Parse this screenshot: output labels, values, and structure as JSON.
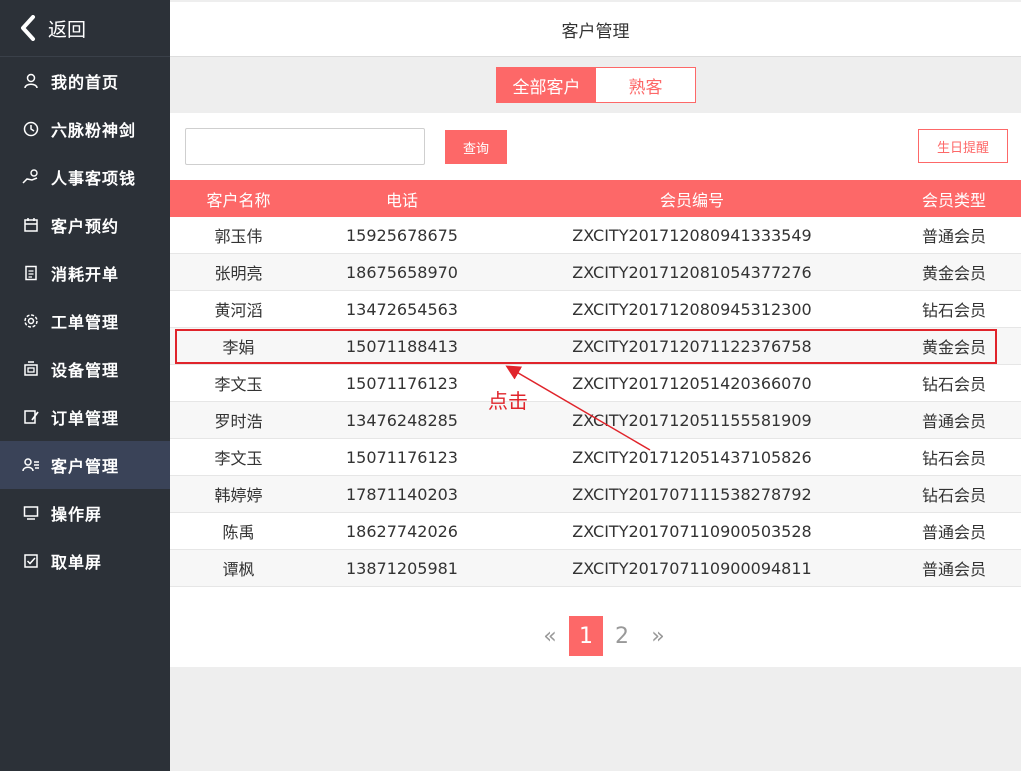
{
  "sidebar": {
    "back_label": "返回",
    "items": [
      {
        "label": "我的首页",
        "icon": "user-icon"
      },
      {
        "label": "六脉粉神剑",
        "icon": "clock-icon"
      },
      {
        "label": "人事客项钱",
        "icon": "hand-coin-icon"
      },
      {
        "label": "客户预约",
        "icon": "calendar-icon"
      },
      {
        "label": "消耗开单",
        "icon": "document-icon"
      },
      {
        "label": "工单管理",
        "icon": "gear-icon"
      },
      {
        "label": "设备管理",
        "icon": "device-icon"
      },
      {
        "label": "订单管理",
        "icon": "edit-document-icon"
      },
      {
        "label": "客户管理",
        "icon": "customers-icon",
        "active": true
      },
      {
        "label": "操作屏",
        "icon": "monitor-icon"
      },
      {
        "label": "取单屏",
        "icon": "checkbox-icon"
      }
    ]
  },
  "header": {
    "title": "客户管理"
  },
  "tabs": {
    "all": "全部客户",
    "regular": "熟客"
  },
  "toolbar": {
    "search_value": "",
    "query_label": "查询",
    "birthday_label": "生日提醒"
  },
  "table": {
    "columns": [
      "客户名称",
      "电话",
      "会员编号",
      "会员类型"
    ],
    "rows": [
      [
        "郭玉伟",
        "15925678675",
        "ZXCITY201712080941333549",
        "普通会员"
      ],
      [
        "张明亮",
        "18675658970",
        "ZXCITY201712081054377276",
        "黄金会员"
      ],
      [
        "黄河滔",
        "13472654563",
        "ZXCITY201712080945312300",
        "钻石会员"
      ],
      [
        "李娟",
        "15071188413",
        "ZXCITY201712071122376758",
        "黄金会员"
      ],
      [
        "李文玉",
        "15071176123",
        "ZXCITY201712051420366070",
        "钻石会员"
      ],
      [
        "罗时浩",
        "13476248285",
        "ZXCITY201712051155581909",
        "普通会员"
      ],
      [
        "李文玉",
        "15071176123",
        "ZXCITY201712051437105826",
        "钻石会员"
      ],
      [
        "韩婷婷",
        "17871140203",
        "ZXCITY201707111538278792",
        "钻石会员"
      ],
      [
        "陈禹",
        "18627742026",
        "ZXCITY201707110900503528",
        "普通会员"
      ],
      [
        "谭枫",
        "13871205981",
        "ZXCITY201707110900094811",
        "普通会员"
      ]
    ]
  },
  "annotation": {
    "text": "点击"
  },
  "pagination": {
    "prev": "«",
    "pages": [
      "1",
      "2"
    ],
    "current": "1",
    "next": "»"
  },
  "colors": {
    "accent": "#fd6868",
    "sidebar": "#2c3138",
    "highlight": "#e0242b"
  }
}
